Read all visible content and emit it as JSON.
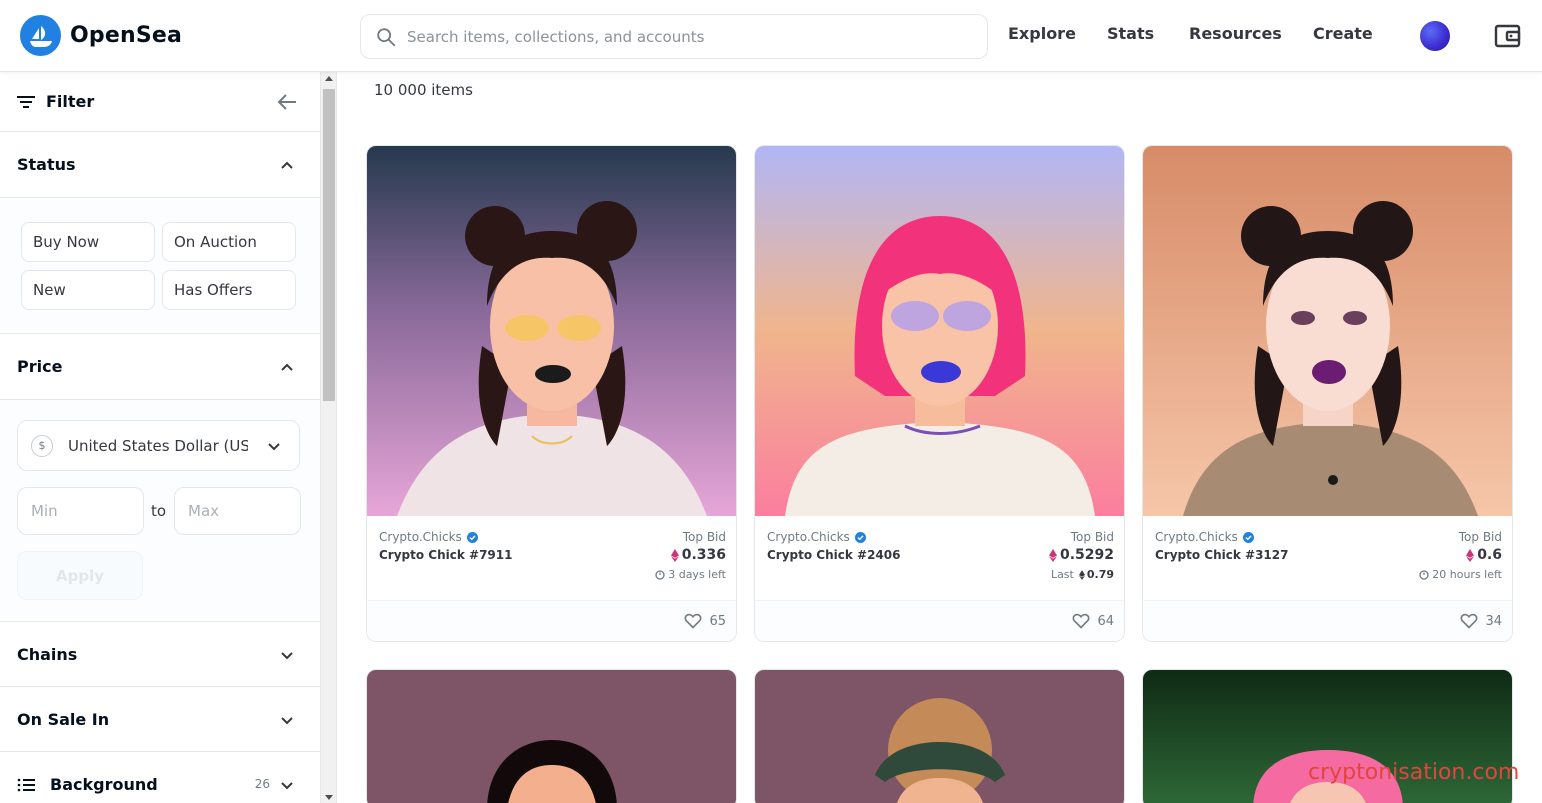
{
  "app": {
    "name": "OpenSea"
  },
  "search": {
    "placeholder": "Search items, collections, and accounts"
  },
  "nav": {
    "explore": "Explore",
    "stats": "Stats",
    "resources": "Resources",
    "create": "Create"
  },
  "sidebar": {
    "filter_label": "Filter",
    "status": {
      "title": "Status",
      "options": [
        "Buy Now",
        "On Auction",
        "New",
        "Has Offers"
      ]
    },
    "price": {
      "title": "Price",
      "currency_symbol": "$",
      "currency": "United States Dollar (USD)",
      "min_placeholder": "Min",
      "max_placeholder": "Max",
      "to_label": "to",
      "apply_label": "Apply"
    },
    "chains": {
      "title": "Chains"
    },
    "on_sale_in": {
      "title": "On Sale In"
    },
    "background": {
      "title": "Background",
      "count": "26"
    }
  },
  "main": {
    "items_count": "10 000 items",
    "cards": [
      {
        "collection": "Crypto.Chicks",
        "name": "Crypto Chick #7911",
        "bid_label": "Top Bid",
        "bid": "0.336",
        "sub": "3 days left",
        "likes": "65"
      },
      {
        "collection": "Crypto.Chicks",
        "name": "Crypto Chick #2406",
        "bid_label": "Top Bid",
        "bid": "0.5292",
        "last_label": "Last",
        "last": "0.79",
        "likes": "64"
      },
      {
        "collection": "Crypto.Chicks",
        "name": "Crypto Chick #3127",
        "bid_label": "Top Bid",
        "bid": "0.6",
        "sub": "20 hours left",
        "likes": "34"
      }
    ]
  },
  "watermark": "cryptonisation.com",
  "colors": {
    "brand": "#2081e2",
    "text": "#04111d",
    "muted": "#707a83",
    "border": "#e5e8eb"
  }
}
